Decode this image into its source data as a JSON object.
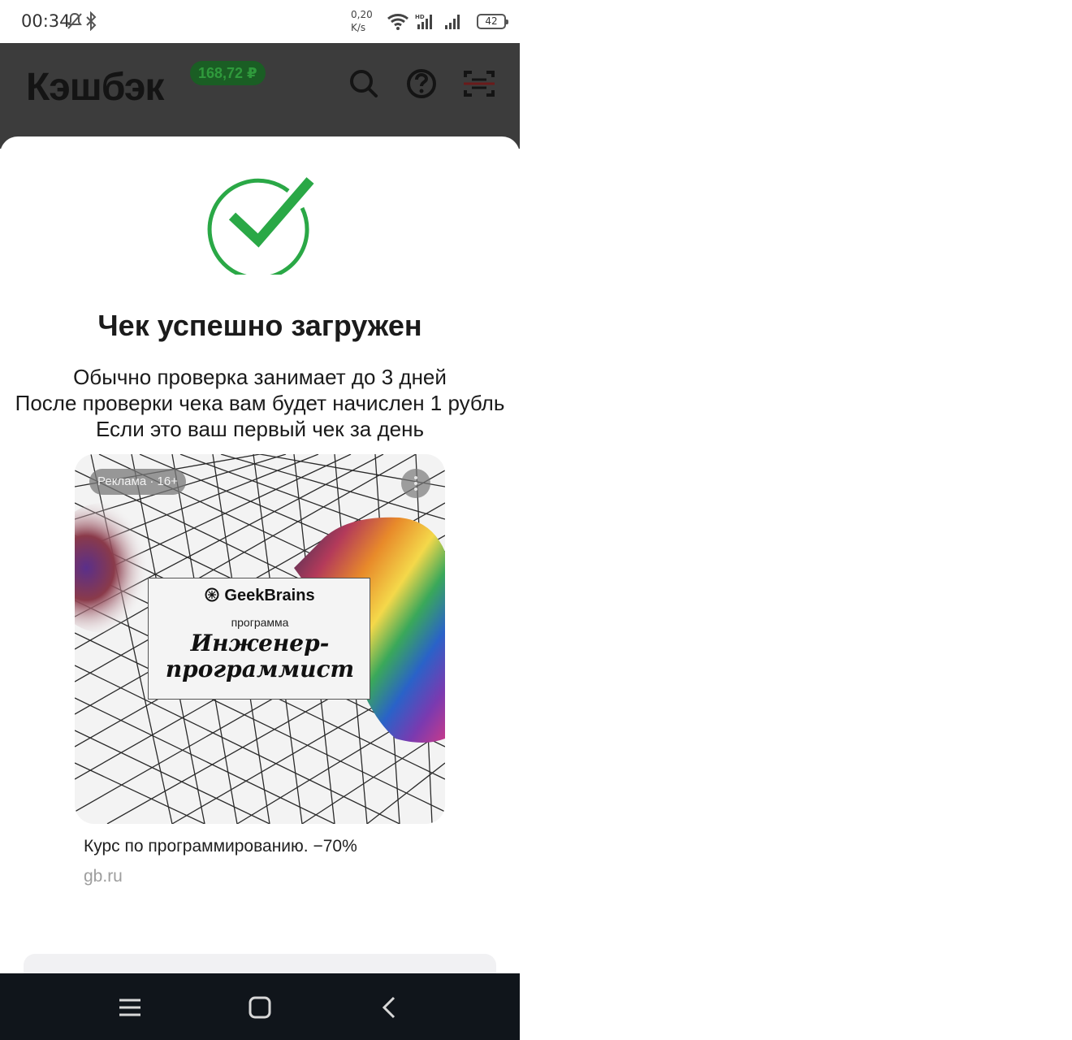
{
  "status_bar": {
    "time": "00:34",
    "net_speed_value": "0,20",
    "net_speed_unit": "K/s",
    "battery": "42",
    "icons": [
      "mute-icon",
      "bluetooth-icon",
      "wifi-icon",
      "signal-hd-icon",
      "signal-icon",
      "battery-icon"
    ]
  },
  "header": {
    "title": "Кэшбэк",
    "balance": "168,72 ₽",
    "icons": [
      "search-icon",
      "help-icon",
      "scan-icon"
    ]
  },
  "sheet": {
    "title": "Чек успешно загружен",
    "description": [
      "Обычно проверка занимает до 3 дней",
      "После проверки чека вам будет начислен 1 рубль",
      "Если это ваш первый чек за день"
    ],
    "accent_color": "#2aa846"
  },
  "ad": {
    "label": "Реклама · 16+",
    "brand": "GeekBrains",
    "program_label": "программа",
    "program_name_line1": "Инженер-",
    "program_name_line2": "программист",
    "headline": "Курс по программированию. −70%",
    "domain": "gb.ru"
  },
  "nav_bar": {
    "icons": [
      "menu-icon",
      "home-icon",
      "back-icon"
    ]
  }
}
